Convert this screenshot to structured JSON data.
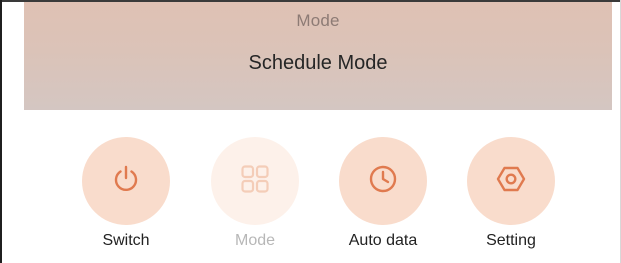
{
  "mode_panel": {
    "title": "Mode",
    "value": "Schedule Mode"
  },
  "actions": [
    {
      "label": "Switch",
      "icon": "power-icon",
      "enabled": true
    },
    {
      "label": "Mode",
      "icon": "grid-icon",
      "enabled": false
    },
    {
      "label": "Auto data",
      "icon": "clock-icon",
      "enabled": true
    },
    {
      "label": "Setting",
      "icon": "hexagon-settings-icon",
      "enabled": true
    }
  ],
  "colors": {
    "accent": "#e07a4f",
    "accent_disabled": "#f4cdb8",
    "circle_bg": "#f9dccc",
    "circle_bg_disabled": "#fdf1ea",
    "panel_bg": "#dcc2b7"
  }
}
